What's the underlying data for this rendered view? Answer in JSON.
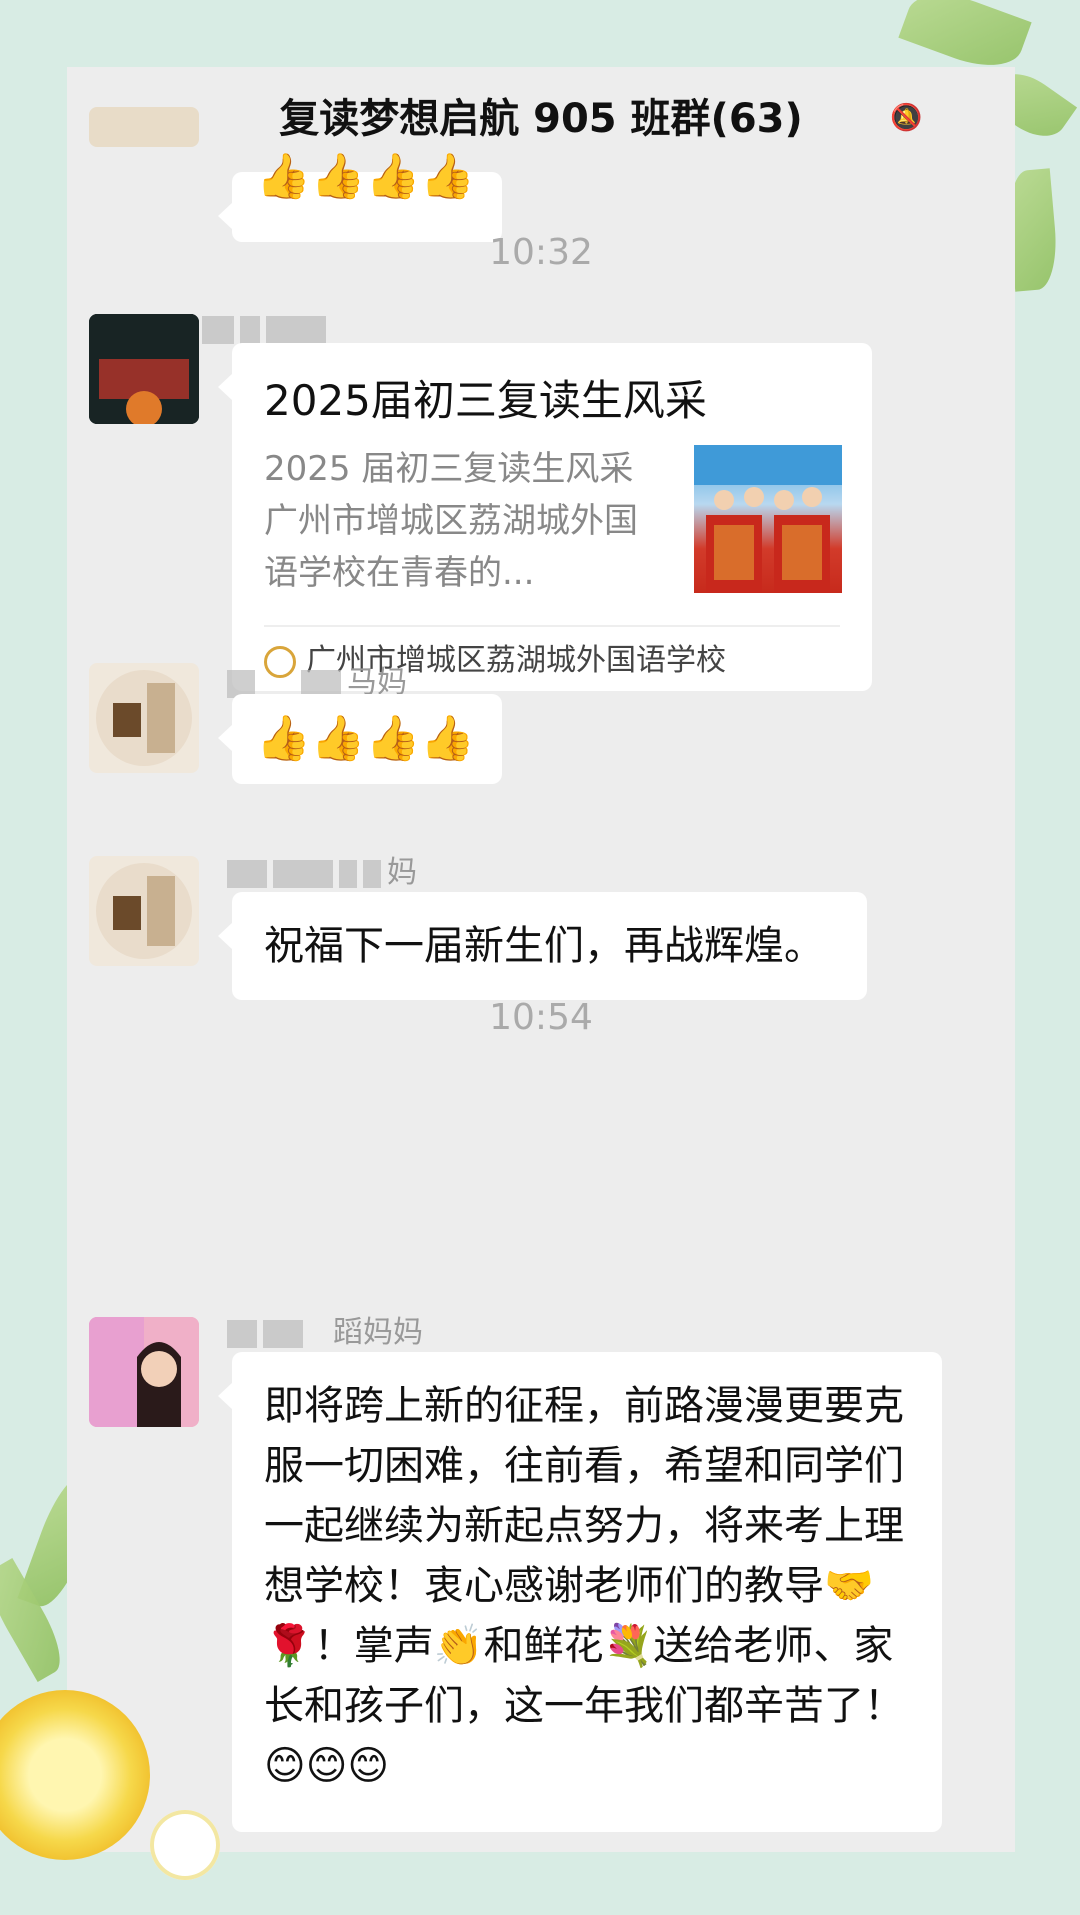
{
  "header": {
    "back_icon": "chevron-left-icon",
    "title": "复读梦想启航 905 班群(63)",
    "mute_icon": "bell-muted-icon"
  },
  "messages": {
    "top_partial": {
      "content": "👍👍👍👍"
    },
    "time1": "10:32",
    "msg1": {
      "name_suffix": "",
      "card_title": "2025届初三复读生风采",
      "card_desc": "2025 届初三复读生风采广州市增城区荔湖城外国语学校在青春的...",
      "card_source": "广州市增城区荔湖城外国语学校"
    },
    "msg2": {
      "name_suffix": "马妈",
      "content": "👍👍👍👍"
    },
    "msg3": {
      "name_suffix": "妈",
      "content": "祝福下一届新生们，再战辉煌。"
    },
    "time2": "10:54",
    "msg4": {
      "name_suffix": "蹈妈妈",
      "content": "即将跨上新的征程，前路漫漫更要克服一切困难，往前看，希望和同学们一起继续为新起点努力，将来考上理想学校！衷心感谢老师们的教导🤝🌹！掌声👏和鲜花💐送给老师、家长和孩子们，这一年我们都辛苦了！😊😊😊"
    }
  }
}
